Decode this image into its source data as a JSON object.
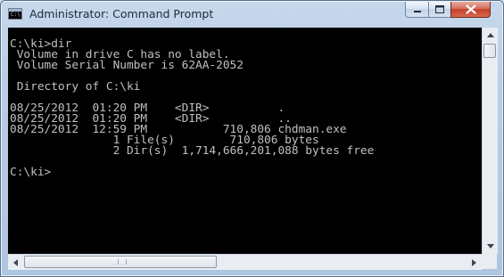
{
  "window": {
    "title": "Administrator: Command Prompt",
    "app_icon_text": "C:\\",
    "controls": {
      "minimize_icon": "minimize-icon",
      "maximize_icon": "maximize-icon",
      "close_icon": "close-icon"
    }
  },
  "console": {
    "lines": [
      "C:\\ki>dir",
      " Volume in drive C has no label.",
      " Volume Serial Number is 62AA-2052",
      "",
      " Directory of C:\\ki",
      "",
      "08/25/2012  01:20 PM    <DIR>          .",
      "08/25/2012  01:20 PM    <DIR>          ..",
      "08/25/2012  12:59 PM           710,806 chdman.exe",
      "               1 File(s)        710,806 bytes",
      "               2 Dir(s)  1,714,666,201,088 bytes free",
      "",
      "C:\\ki>"
    ]
  },
  "colors": {
    "console_background": "#000000",
    "console_text": "#c0c0c0",
    "close_button": "#c2412a"
  }
}
